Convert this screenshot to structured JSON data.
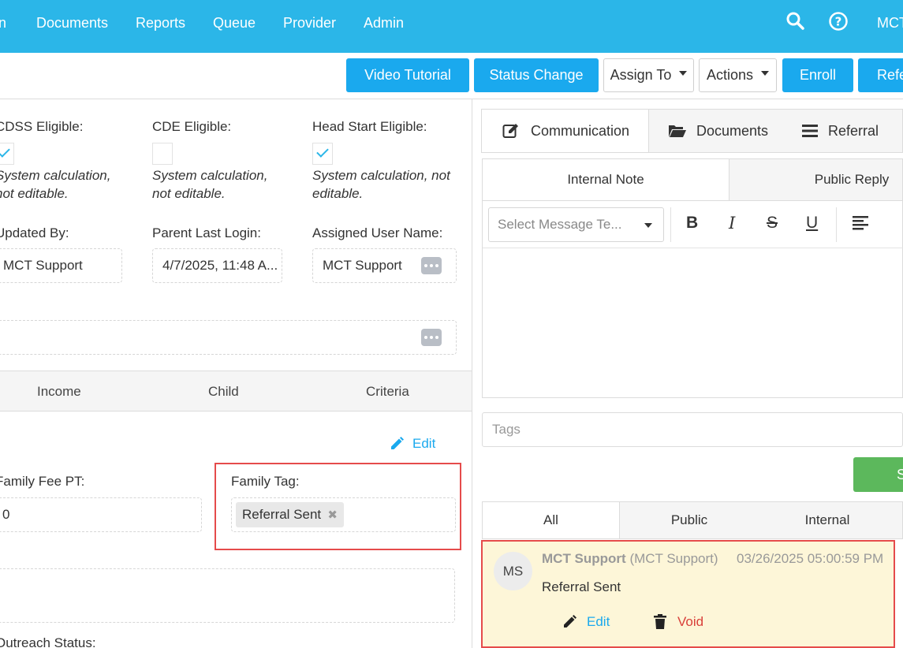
{
  "nav": {
    "partial_first": "n",
    "items": [
      "Documents",
      "Reports",
      "Queue",
      "Provider",
      "Admin"
    ],
    "user_partial": "MCT"
  },
  "actions": {
    "video_tutorial": "Video Tutorial",
    "status_change": "Status Change",
    "assign_to": "Assign To",
    "actions": "Actions",
    "enroll": "Enroll",
    "referral_partial": "Refe"
  },
  "eligibility": {
    "cdss": {
      "label": "CDSS Eligible:",
      "note_line1": "System calculation,",
      "note_line2": "not editable."
    },
    "cde": {
      "label": "CDE Eligible:",
      "note_line1": "System calculation,",
      "note_line2": "not editable."
    },
    "head_start": {
      "label": "Head Start Eligible:",
      "note_line1": "System calculation, not",
      "note_line2": "editable."
    }
  },
  "info": {
    "updated_by": {
      "label": "Updated By:",
      "value": "MCT Support"
    },
    "parent_last_login": {
      "label": "Parent Last Login:",
      "value": "4/7/2025, 11:48 A..."
    },
    "assigned_user": {
      "label": "Assigned User Name:",
      "value": "MCT Support"
    }
  },
  "left_tabs": [
    "Income",
    "Child",
    "Criteria"
  ],
  "edit_label": "Edit",
  "family_fee": {
    "label": "Family Fee PT:",
    "value": "0"
  },
  "family_tag": {
    "label": "Family Tag:",
    "chip": "Referral Sent"
  },
  "outreach_label": "Outreach Status:",
  "right_tabs": [
    "Communication",
    "Documents",
    "Referral"
  ],
  "sub_tabs": [
    "Internal Note",
    "Public Reply"
  ],
  "editor": {
    "select_placeholder": "Select Message Te..."
  },
  "tags_placeholder": "Tags",
  "send_partial": "S",
  "filter_tabs": [
    "All",
    "Public",
    "Internal"
  ],
  "note": {
    "initials": "MS",
    "author": "MCT Support",
    "author_role": "(MCT Support)",
    "timestamp": "03/26/2025 05:00:59 PM",
    "body": "Referral Sent",
    "edit": "Edit",
    "void": "Void"
  },
  "colors": {
    "nav": "#2bb6e8",
    "primary": "#1aa9ee",
    "highlight": "#e54b4b",
    "note_bg": "#fdf6d8",
    "send": "#5cb85c"
  }
}
